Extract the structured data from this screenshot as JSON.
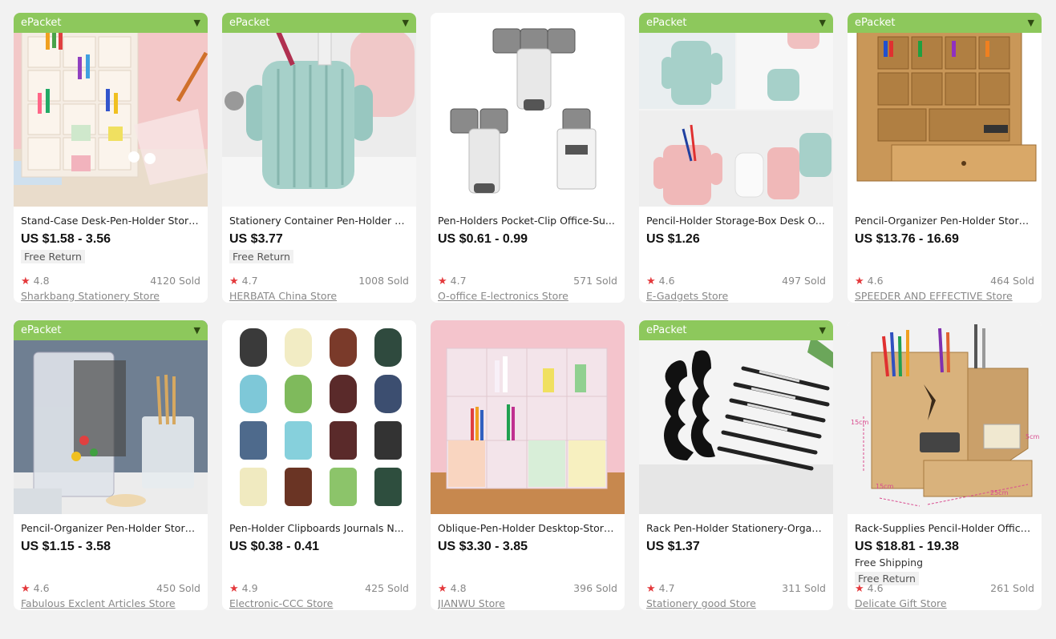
{
  "products": [
    {
      "epacket": true,
      "title": "Stand-Case Desk-Pen-Holder Stora...",
      "price": "US $1.58 - 3.56",
      "shipping": "",
      "free_return": "Free Return",
      "rating": "4.8",
      "sold": "4120 Sold",
      "store": "Sharkbang Stationery Store",
      "image": "desk-organizer-pink-icon"
    },
    {
      "epacket": true,
      "title": "Stationery Container Pen-Holder B...",
      "price": "US $3.77",
      "shipping": "",
      "free_return": "Free Return",
      "rating": "4.7",
      "sold": "1008 Sold",
      "store": "HERBATA China Store",
      "image": "cactus-pen-holder-icon"
    },
    {
      "epacket": false,
      "title": "Pen-Holders Pocket-Clip Office-Su...",
      "price": "US $0.61 - 0.99",
      "shipping": "",
      "free_return": "",
      "rating": "4.7",
      "sold": "571 Sold",
      "store": "O-office E-lectronics Store",
      "image": "pen-clip-icon"
    },
    {
      "epacket": true,
      "title": "Pencil-Holder Storage-Box Desk O...",
      "price": "US $1.26",
      "shipping": "",
      "free_return": "",
      "rating": "4.6",
      "sold": "497 Sold",
      "store": "E-Gadgets Store",
      "image": "cactus-collage-icon"
    },
    {
      "epacket": true,
      "title": "Pencil-Organizer Pen-Holder Stora...",
      "price": "US $13.76 - 16.69",
      "shipping": "",
      "free_return": "",
      "rating": "4.6",
      "sold": "464 Sold",
      "store": "SPEEDER AND EFFECTIVE Store",
      "image": "wood-organizer-icon"
    },
    {
      "epacket": true,
      "title": "Pencil-Organizer Pen-Holder Stora...",
      "price": "US $1.15 - 3.58",
      "shipping": "",
      "free_return": "",
      "rating": "4.6",
      "sold": "450 Sold",
      "store": "Fabulous Exclent Articles Store",
      "image": "clear-organizer-icon"
    },
    {
      "epacket": false,
      "title": "Pen-Holder Clipboards Journals N...",
      "price": "US $0.38 - 0.41",
      "shipping": "",
      "free_return": "",
      "rating": "4.9",
      "sold": "425 Sold",
      "store": "Electronic-CCC Store",
      "image": "leather-loops-icon"
    },
    {
      "epacket": false,
      "title": "Oblique-Pen-Holder Desktop-Stora...",
      "price": "US $3.30 - 3.85",
      "shipping": "",
      "free_return": "",
      "rating": "4.8",
      "sold": "396 Sold",
      "store": "JIANWU Store",
      "image": "pastel-organizer-icon"
    },
    {
      "epacket": true,
      "title": "Rack Pen-Holder Stationery-Organi...",
      "price": "US $1.37",
      "shipping": "",
      "free_return": "",
      "rating": "4.7",
      "sold": "311 Sold",
      "store": "Stationery good Store",
      "image": "pen-rack-icon"
    },
    {
      "epacket": false,
      "title": "Rack-Supplies Pencil-Holder Office...",
      "price": "US $18.81 - 19.38",
      "shipping": "Free Shipping",
      "free_return": "Free Return",
      "rating": "4.6",
      "sold": "261 Sold",
      "store": "Delicate Gift Store",
      "image": "wood-rack-icon"
    }
  ],
  "labels": {
    "epacket": "ePacket",
    "image_dimensions": [
      "15cm",
      "25cm",
      "5cm",
      "15cm"
    ]
  },
  "colors": {
    "epacket_bg": "#8dc85c",
    "star": "#e4393c",
    "page_bg": "#f2f2f2"
  }
}
